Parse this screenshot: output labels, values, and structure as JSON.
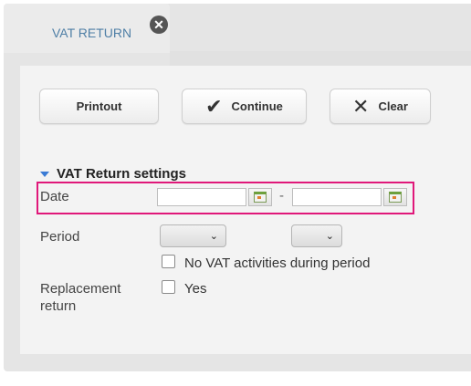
{
  "tab": {
    "label": "VAT RETURN",
    "close_glyph": "✕"
  },
  "toolbar": {
    "printout_label": "Printout",
    "continue_label": "Continue",
    "continue_icon": "✔",
    "clear_label": "Clear",
    "clear_icon": "✕"
  },
  "settings": {
    "title": "VAT Return settings",
    "date_label": "Date",
    "date_from_value": "",
    "date_to_value": "",
    "date_separator": "-",
    "period_label": "Period",
    "period_from_value": "",
    "period_to_value": "",
    "no_vat_label": "No VAT activities during period",
    "no_vat_checked": false,
    "replacement_label_line1": "Replacement",
    "replacement_label_line2": "return",
    "replacement_yes_label": "Yes",
    "replacement_checked": false
  },
  "colors": {
    "tab_text": "#4f7fa6",
    "highlight_border": "#e0187a",
    "section_arrow": "#3a7bd5"
  }
}
